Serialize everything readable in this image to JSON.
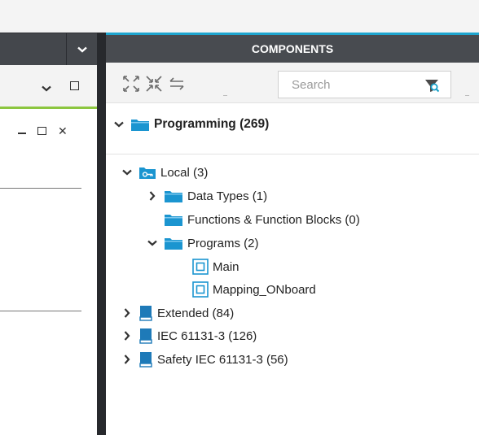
{
  "components_panel": {
    "title": "COMPONENTS",
    "search": {
      "placeholder": "Search",
      "value": ""
    },
    "toolbar": {
      "expand_icon": "expand-all-icon",
      "collapse_icon": "collapse-all-icon",
      "sync_icon": "sync-arrows-icon",
      "filter_icon": "filter-search-icon"
    },
    "tree": {
      "root": {
        "label": "Programming (269)",
        "expanded": true
      },
      "local": {
        "label": "Local (3)",
        "expanded": true
      },
      "data_types": {
        "label": "Data Types (1)"
      },
      "functions": {
        "label": "Functions & Function Blocks (0)"
      },
      "programs": {
        "label": "Programs (2)",
        "expanded": true
      },
      "main": {
        "label": "Main"
      },
      "mapping": {
        "label": "Mapping_ONboard"
      },
      "extended": {
        "label": "Extended (84)"
      },
      "iec": {
        "label": "IEC 61131-3 (126)"
      },
      "safety": {
        "label": "Safety IEC 61131-3 (56)"
      }
    }
  },
  "colors": {
    "header_bg": "#484b50",
    "header_accent": "#1ea5cf",
    "active_tab_accent": "#8cc63f",
    "folder_blue": "#1b95d0",
    "book_blue": "#1e7ab8",
    "divider": "#27292d"
  }
}
